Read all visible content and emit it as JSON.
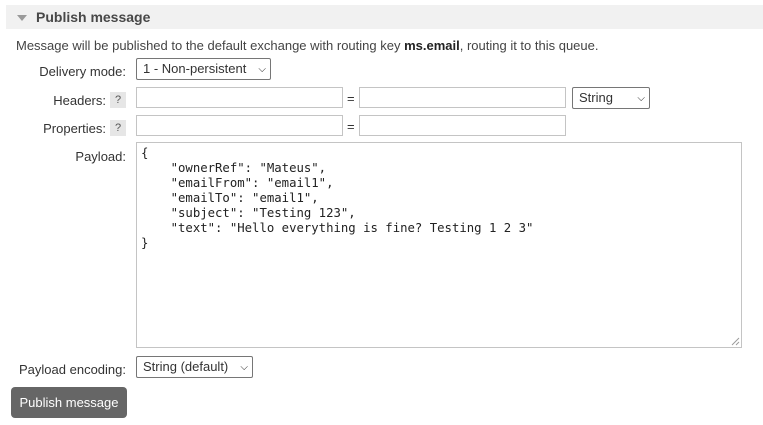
{
  "section": {
    "title": "Publish message",
    "icon": "triangle-down-icon"
  },
  "info": {
    "prefix": "Message will be published to the default exchange with routing key ",
    "routing_key": "ms.email",
    "suffix": ", routing it to this queue."
  },
  "delivery_mode": {
    "label": "Delivery mode:",
    "selected": "1 - Non-persistent"
  },
  "headers": {
    "label": "Headers:",
    "help": "?",
    "equals": "=",
    "key_value": "",
    "value_value": "",
    "type_selected": "String"
  },
  "properties": {
    "label": "Properties:",
    "help": "?",
    "equals": "=",
    "key_value": "",
    "value_value": ""
  },
  "payload": {
    "label": "Payload:",
    "text": "{\n    \"ownerRef\": \"Mateus\",\n    \"emailFrom\": \"email1\",\n    \"emailTo\": \"email1\",\n    \"subject\": \"Testing 123\",\n    \"text\": \"Hello everything is fine? Testing 1 2 3\"\n}"
  },
  "payload_encoding": {
    "label": "Payload encoding:",
    "selected": "String (default)"
  },
  "publish_button": {
    "label": "Publish message"
  },
  "colors": {
    "header_bg": "#f1f1f1",
    "button_bg": "#666666",
    "button_text": "#ffffff"
  }
}
